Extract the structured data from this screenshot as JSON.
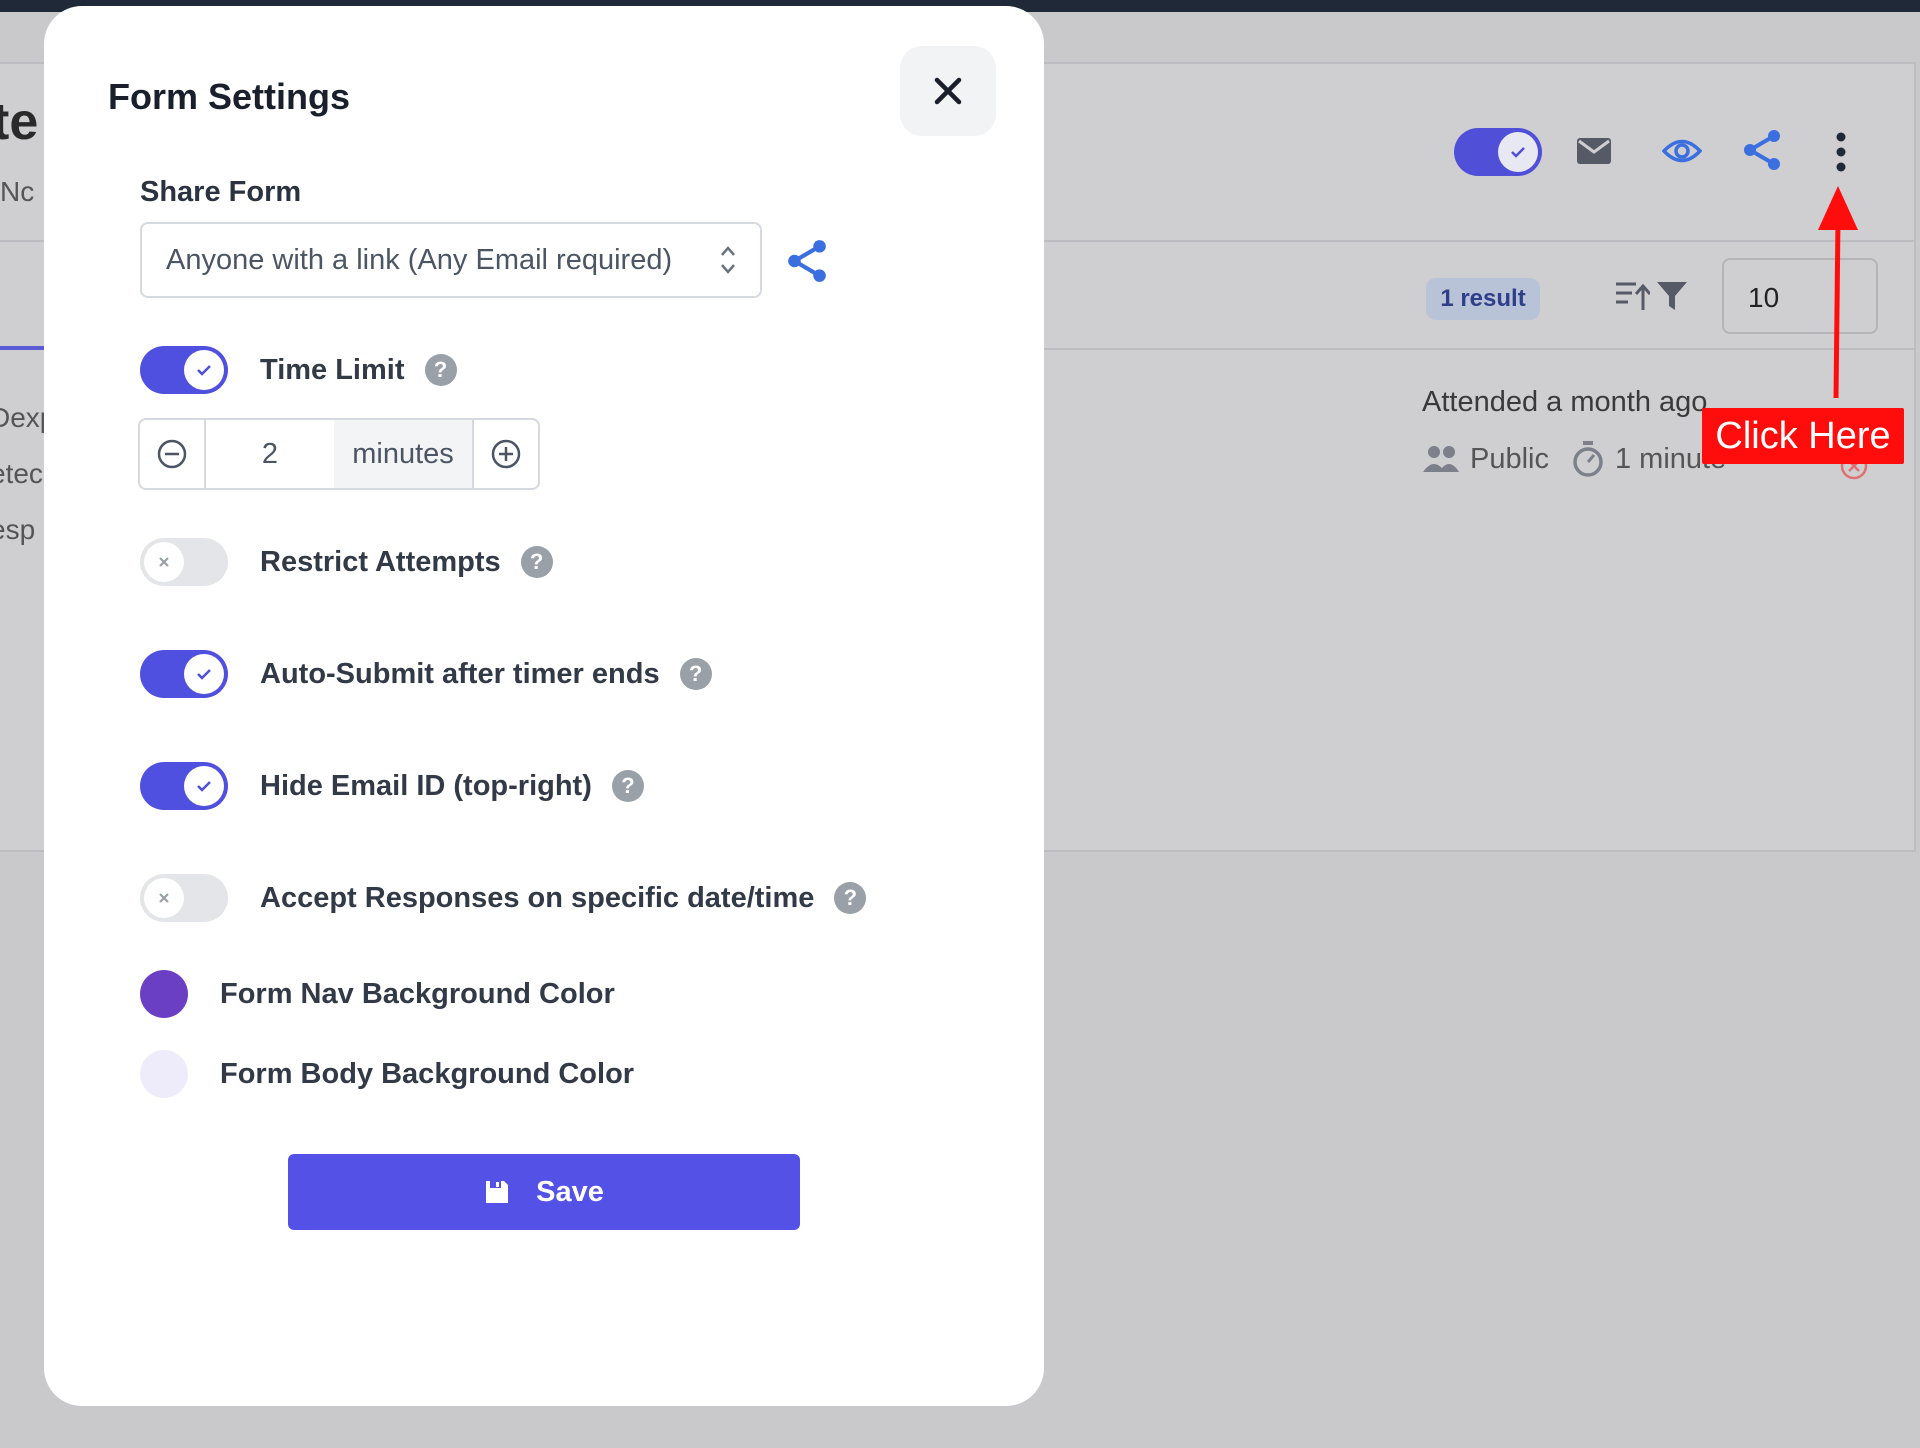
{
  "background": {
    "title_fragment": "te",
    "subtitle_fragment": "Nc",
    "side_items": [
      "Dexp",
      "etec",
      "esp"
    ],
    "results_badge": "1 result",
    "page_size": "10",
    "attended": "Attended a month ago",
    "visibility": "Public",
    "duration": "1 minute",
    "toggle_enabled": true
  },
  "callout": {
    "text": "Click Here",
    "color": "#ff0d0d"
  },
  "modal": {
    "title": "Form Settings",
    "share": {
      "label": "Share Form",
      "selected": "Anyone with a link (Any Email required)"
    },
    "time_limit": {
      "label": "Time Limit",
      "enabled": true,
      "value": "2",
      "unit": "minutes"
    },
    "toggles": [
      {
        "label": "Restrict Attempts",
        "enabled": false
      },
      {
        "label": "Auto-Submit after timer ends",
        "enabled": true
      },
      {
        "label": "Hide Email ID (top-right)",
        "enabled": true
      },
      {
        "label": "Accept Responses on specific date/time",
        "enabled": false
      }
    ],
    "colors": [
      {
        "label": "Form Nav Background Color",
        "value": "#6b3fc4"
      },
      {
        "label": "Form Body Background Color",
        "value": "#eeecfa"
      }
    ],
    "save_label": "Save",
    "help_glyph": "?"
  },
  "theme": {
    "accent": "#4f4fe0",
    "save": "#5451e6",
    "share_icon": "#3b6fe0"
  }
}
